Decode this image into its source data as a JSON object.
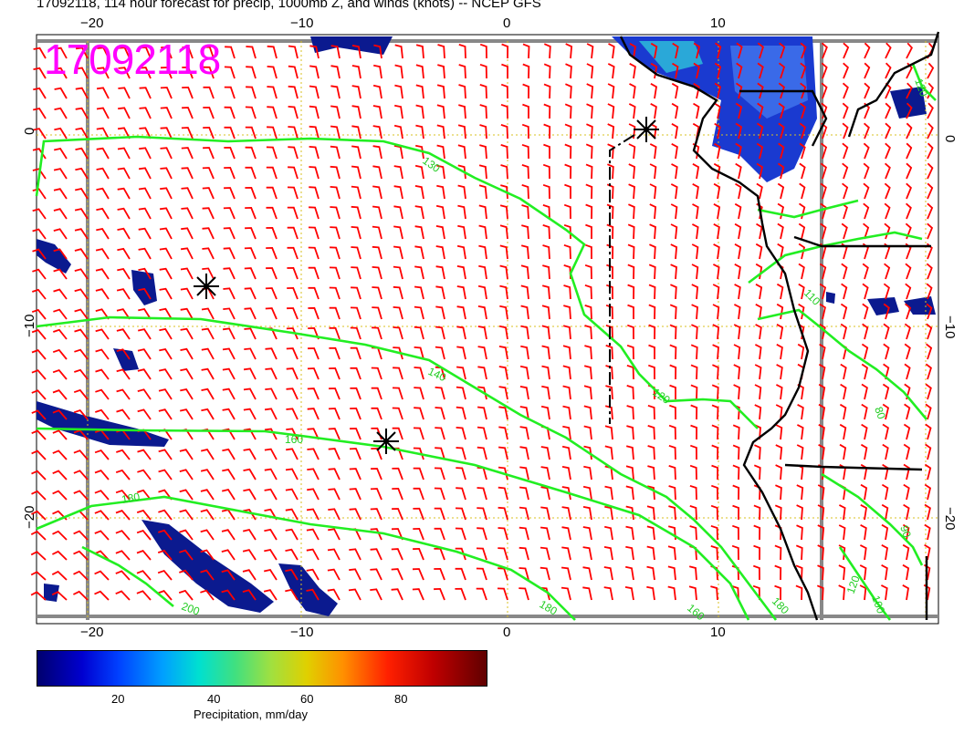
{
  "title": "17092118, 114 hour forecast for precip, 1000mb Z, and winds (knots) -- NCEP GFS",
  "stamp": "17092118",
  "axes": {
    "lon_labels": [
      "−20",
      "−10",
      "0",
      "10"
    ],
    "lat_labels": [
      "0",
      "−10",
      "−20"
    ]
  },
  "contour_labels": [
    "130",
    "140",
    "160",
    "180",
    "180",
    "200",
    "120",
    "160",
    "180",
    "110",
    "120",
    "80",
    "90",
    "100",
    "120",
    "160",
    "180"
  ],
  "colorbar": {
    "title": "Precipitation, mm/day",
    "tick_labels": [
      "20",
      "40",
      "60",
      "80"
    ]
  },
  "colors": {
    "stamp": "#ff00ff",
    "wind_barbs": "#ff0000",
    "height_contours": "#22ee22",
    "precip_low": "#00008b",
    "coastline": "#000000",
    "gridlines": "#d8c020"
  }
}
